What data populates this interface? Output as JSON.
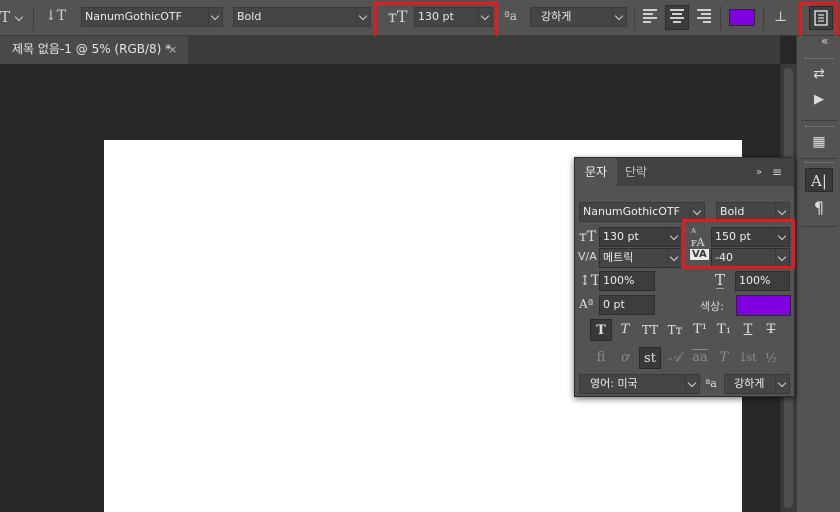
{
  "toolbar": {
    "tool_glyph": "T",
    "orientation_glyph": "↓T",
    "font_family": "NanumGothicOTF",
    "font_style": "Bold",
    "size_icon": "ᴛT",
    "font_size": "130 pt",
    "aa_icon": "ªa",
    "anti_alias": "강하게",
    "text_color": "#8000e0",
    "warp_icon": "warp-text-icon",
    "panel_toggle_icon": "character-paragraph-panels-icon"
  },
  "document": {
    "tab_title": "제목 없음-1 @ 5% (RGB/8) *",
    "close_glyph": "×"
  },
  "dock": {
    "collapse_glyph": "«",
    "icons": [
      "history-icon",
      "play-icon",
      "3d-icon",
      "character-icon",
      "paragraph-icon"
    ]
  },
  "panel": {
    "tabs": [
      "문자",
      "단락"
    ],
    "expand_glyph": "»",
    "menu_glyph": "≡",
    "font_family": "NanumGothicOTF",
    "font_style": "Bold",
    "font_size": "130 pt",
    "leading": "150 pt",
    "kerning": "메트릭",
    "tracking": "-40",
    "vertical_scale": "100%",
    "horizontal_scale": "100%",
    "baseline_shift": "0 pt",
    "color_label": "색상:",
    "color": "#8000e0",
    "type_style_buttons": [
      "T",
      "T",
      "TT",
      "Tт",
      "T¹",
      "T₁",
      "T",
      "T"
    ],
    "opentype_buttons": [
      "fi",
      "ơ",
      "st",
      "𝒜",
      "aa",
      "T",
      "1st",
      "½"
    ],
    "language": "영어: 미국",
    "aa_icon": "ªa",
    "anti_alias": "강하게"
  }
}
